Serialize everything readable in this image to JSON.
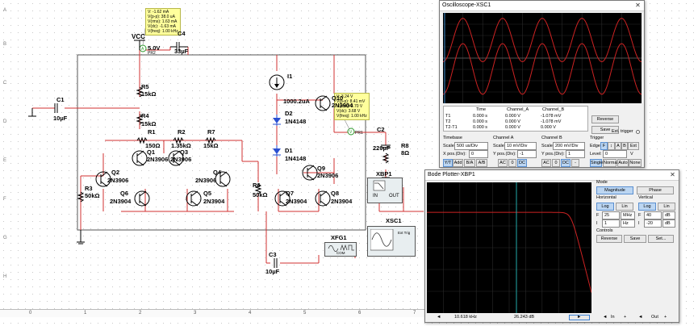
{
  "schematic": {
    "vcc_label": "VCC",
    "vcc_value": "5.0V",
    "vcc_pr": "PR2",
    "probe_pr2": [
      "V: -1.62 mA",
      "V(p-p): 38.0 uA",
      "V(rms): 1.63 mA",
      "V(dc): -1.63 mA",
      "V(freq): 1.00 kHz"
    ],
    "probe_pr1": [
      "V: 3.24 V",
      "V(p-p): 8.41 mV",
      "V(rms): 3.70 V",
      "V(dc): 3.68 V",
      "V(freq): 1.00 kHz"
    ],
    "pr1_label": "PR1",
    "labels": {
      "c4": "C4",
      "c4v": "33µF",
      "c1": "C1",
      "c1v": "10µF",
      "r5": "R5",
      "r5v": "15kΩ",
      "r4": "R4",
      "r4v": "15kΩ",
      "r1": "R1",
      "r1v": "150Ω",
      "r2": "R2",
      "r2v": "1.35kΩ",
      "r7": "R7",
      "r7v": "15kΩ",
      "r3": "R3",
      "r3v": "50kΩ",
      "r6": "R6",
      "r6v": "50kΩ",
      "r8": "R8",
      "r8v": "8Ω",
      "c2": "C2",
      "c2v": "220µF",
      "c3": "C3",
      "c3v": "10µF",
      "i1": "I1",
      "i1v": "1000.2uA",
      "d1": "D1",
      "d1v": "1N4148",
      "d2": "D2",
      "d2v": "1N4148",
      "q1": "Q1",
      "q1v": "2N3906",
      "q2": "Q2",
      "q2v": "2N3906",
      "q3": "Q3",
      "q3v": "2N3906",
      "q4": "Q4",
      "q4v": "2N3906",
      "q5": "Q5",
      "q5v": "2N3904",
      "q6": "Q6",
      "q6v": "2N3904",
      "q7": "Q7",
      "q7v": "2N3904",
      "q8": "Q8",
      "q8v": "2N3904",
      "q9": "Q9",
      "q9v": "2N3906",
      "q10": "Q10",
      "q10v": "2N3904",
      "xbp1": "XBP1",
      "xsc1": "XSC1",
      "xfg1": "XFG1",
      "in": "IN",
      "out": "OUT",
      "com": "COM",
      "ext_trig": "Ext Trig"
    },
    "border_rows": [
      "A",
      "B",
      "C",
      "D",
      "E",
      "F",
      "G",
      "H"
    ],
    "border_cols": [
      "0",
      "1",
      "2",
      "3",
      "4",
      "5",
      "6",
      "7"
    ]
  },
  "oscilloscope": {
    "title": "Oscilloscope-XSC1",
    "channel_a_color": "#cc2222",
    "channel_b_color": "#cc2222",
    "readout_headers": [
      "Time",
      "Channel_A",
      "Channel_B"
    ],
    "rows": [
      {
        "label": "T1",
        "time": "0.000 s",
        "a": "0.000 V",
        "b": "-1.078 mV"
      },
      {
        "label": "T2",
        "time": "0.000 s",
        "a": "0.000 V",
        "b": "-1.078 mV"
      },
      {
        "label": "T2-T1",
        "time": "0.000 s",
        "a": "0.000 V",
        "b": "0.000 V"
      }
    ],
    "reverse": "Reverse",
    "save": "Save",
    "ext_trigger": "Ext. trigger",
    "timebase": {
      "title": "Timebase",
      "scale_label": "Scale:",
      "scale": "500 us/Div",
      "xpos_label": "X pos.(Div):",
      "xpos": "0",
      "modes": [
        "Y/T",
        "Add",
        "B/A",
        "A/B"
      ]
    },
    "channel_a": {
      "title": "Channel A",
      "scale_label": "Scale:",
      "scale": "10 mV/Div",
      "ypos_label": "Y pos.(Div):",
      "ypos": "-1",
      "coupling": [
        "AC",
        "0",
        "DC"
      ]
    },
    "channel_b": {
      "title": "Channel B",
      "scale_label": "Scale:",
      "scale": "200 mV/Div",
      "ypos_label": "Y pos.(Div):",
      "ypos": "1",
      "coupling": [
        "AC",
        "0",
        "DC",
        "-"
      ]
    },
    "trigger": {
      "title": "Trigger",
      "edge_label": "Edge:",
      "edges": [
        "F",
        "↕",
        "A",
        "B",
        "Ext"
      ],
      "level_label": "Level:",
      "level": "0",
      "level_unit": "V",
      "modes": [
        "Single",
        "Normal",
        "Auto",
        "None"
      ]
    }
  },
  "bode": {
    "title": "Bode Plotter-XBP1",
    "trace_color": "#cc2222",
    "cursor_color": "#22aaaa",
    "mode_title": "Mode",
    "magnitude": "Magnitude",
    "phase": "Phase",
    "horizontal": {
      "title": "Horizontal",
      "log": "Log",
      "lin": "Lin",
      "f_label": "F",
      "f_value": "25",
      "f_unit": "MHz",
      "i_label": "I",
      "i_value": "1",
      "i_unit": "Hz"
    },
    "vertical": {
      "title": "Vertical",
      "log": "Log",
      "lin": "Lin",
      "f_label": "F",
      "f_value": "40",
      "f_unit": "dB",
      "i_label": "I",
      "i_value": "-20",
      "i_unit": "dB"
    },
    "controls_title": "Controls",
    "reverse": "Reverse",
    "save": "Save",
    "set": "Set...",
    "readout_freq": "10.618 kHz",
    "readout_db": "26.243 dB",
    "in_label": "In",
    "out_label": "Out"
  }
}
